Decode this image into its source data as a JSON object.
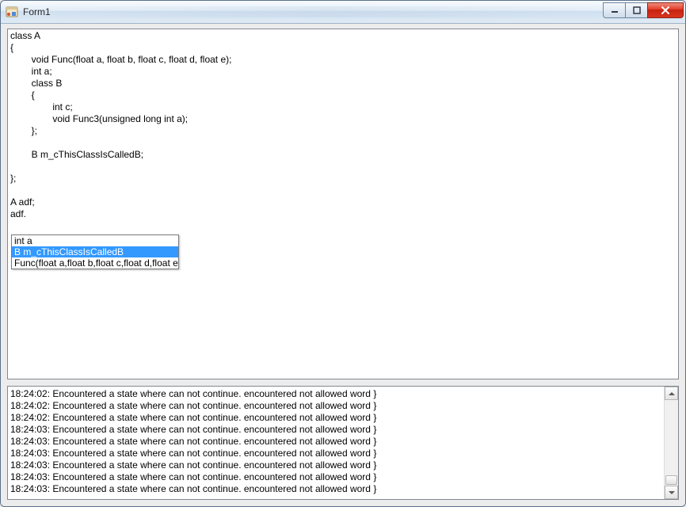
{
  "window": {
    "title": "Form1"
  },
  "editor": {
    "code": "class A\n{\n\tvoid Func(float a, float b, float c, float d, float e);\n\tint a;\n\tclass B\n\t{\n\t\tint c;\n\t\tvoid Func3(unsigned long int a);\n\t};\n\n\tB m_cThisClassIsCalledB;\n\n};\n\nA adf;\nadf."
  },
  "autocomplete": {
    "selected_index": 1,
    "items": [
      "int a",
      "B m_cThisClassIsCalledB",
      "Func(float a,float b,float c,float d,float e,)"
    ]
  },
  "log": {
    "lines": [
      "18:24:02: Encountered a state where can not continue. encountered not allowed word }",
      "18:24:02: Encountered a state where can not continue. encountered not allowed word }",
      "18:24:02: Encountered a state where can not continue. encountered not allowed word }",
      "18:24:03: Encountered a state where can not continue. encountered not allowed word }",
      "18:24:03: Encountered a state where can not continue. encountered not allowed word }",
      "18:24:03: Encountered a state where can not continue. encountered not allowed word }",
      "18:24:03: Encountered a state where can not continue. encountered not allowed word }",
      "18:24:03: Encountered a state where can not continue. encountered not allowed word }",
      "18:24:03: Encountered a state where can not continue. encountered not allowed word }"
    ]
  }
}
